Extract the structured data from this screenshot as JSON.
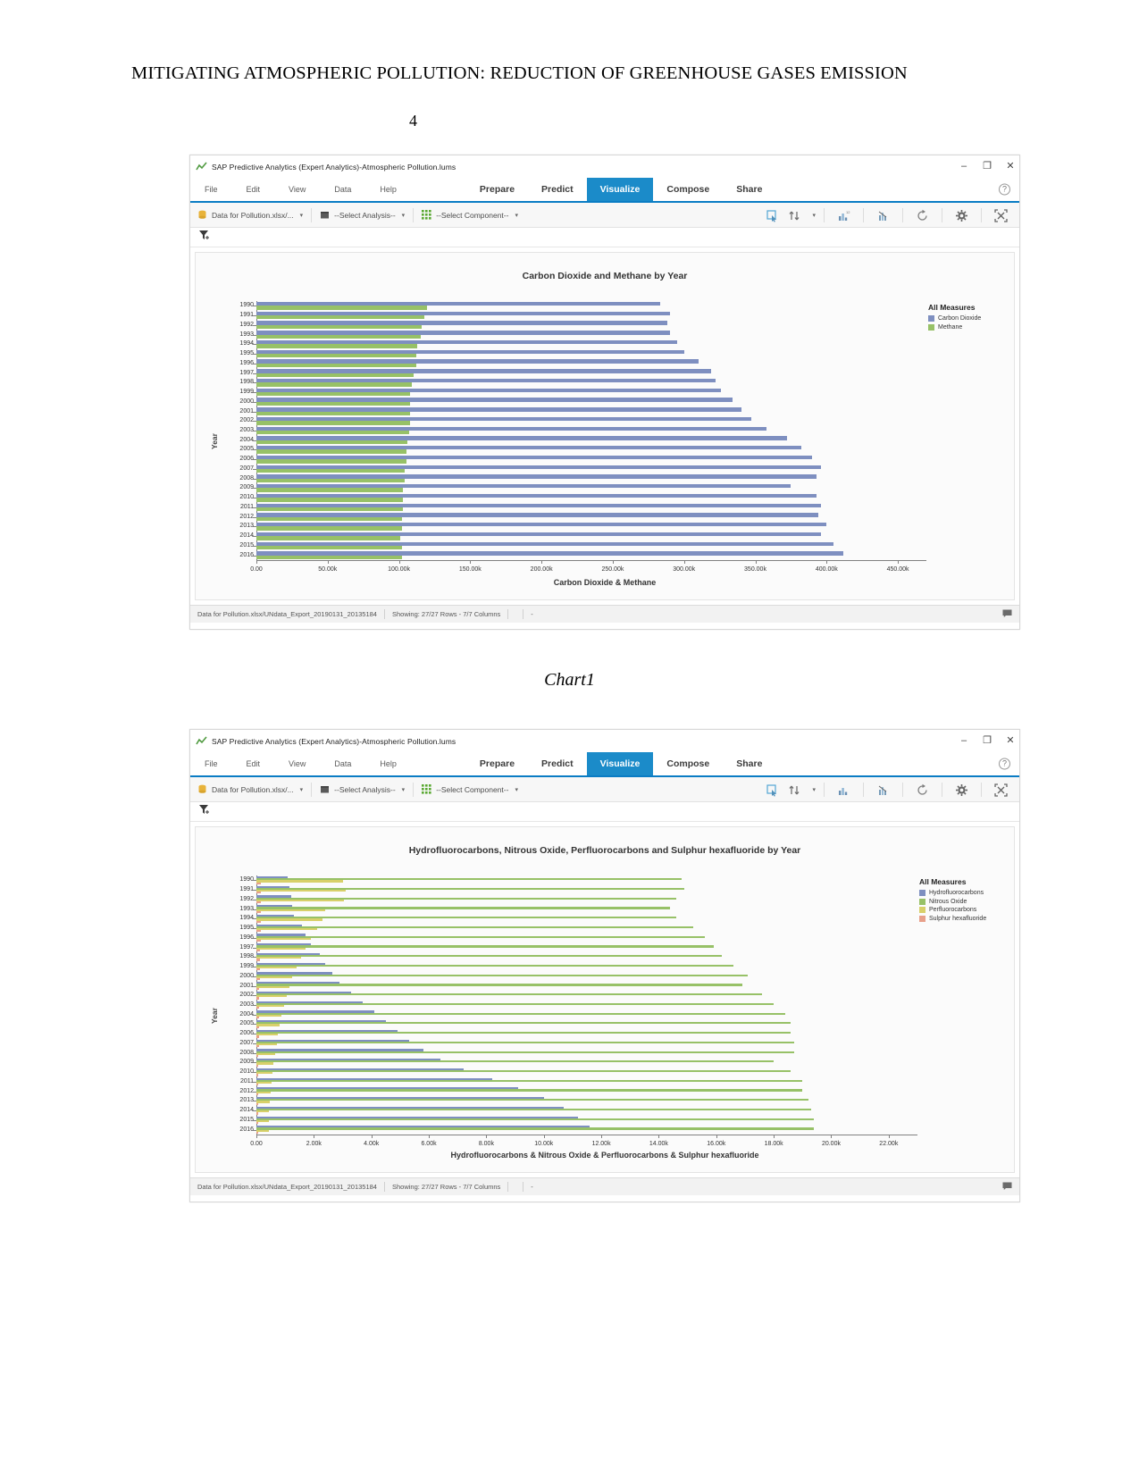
{
  "document": {
    "header_title": "MITIGATING ATMOSPHERIC POLLUTION: REDUCTION OF GREENHOUSE GASES EMISSION",
    "page_number": "4",
    "caption1": "Chart1"
  },
  "window": {
    "title": "SAP Predictive Analytics (Expert Analytics)-Atmospheric Pollution.lums",
    "app_icon": "chart-app-icon",
    "controls": {
      "minimize": "–",
      "maximize": "❐",
      "close": "✕"
    },
    "menu_left": [
      "File",
      "Edit",
      "View",
      "Data",
      "Help"
    ],
    "menu_main": [
      "Prepare",
      "Predict",
      "Visualize",
      "Compose",
      "Share"
    ],
    "menu_active": "Visualize",
    "help_glyph": "?",
    "toolbar": {
      "dataset": "Data for Pollution.xlsx/...",
      "analysis": "--Select Analysis--",
      "component": "--Select Component--",
      "right_icons": [
        "select-tool-icon",
        "sort-icon",
        "chart-bar-icon",
        "chart-scatter-icon",
        "refresh-icon",
        "settings-icon",
        "fullscreen-icon"
      ]
    },
    "filter_icon": "filter-add-icon",
    "status": {
      "file": "Data for Pollution.xlsx/UNdata_Export_20190131_20135184",
      "rows": "Showing: 27/27 Rows - 7/7 Columns",
      "dash": "-",
      "comment_icon": "comment-icon"
    }
  },
  "chart_data": [
    {
      "type": "bar",
      "orientation": "horizontal",
      "title": "Carbon Dioxide and Methane by Year",
      "xlabel": "Carbon Dioxide & Methane",
      "ylabel": "Year",
      "legend_title": "All Measures",
      "legend_position": "right",
      "grid": false,
      "xlim": [
        0,
        470000
      ],
      "xticks": [
        "0.00",
        "50.00k",
        "100.00k",
        "150.00k",
        "200.00k",
        "250.00k",
        "300.00k",
        "350.00k",
        "400.00k",
        "450.00k"
      ],
      "xtick_values": [
        0,
        50000,
        100000,
        150000,
        200000,
        250000,
        300000,
        350000,
        400000,
        450000
      ],
      "categories": [
        "1990",
        "1991",
        "1992",
        "1993",
        "1994",
        "1995",
        "1996",
        "1997",
        "1998",
        "1999",
        "2000",
        "2001",
        "2002",
        "2003",
        "2004",
        "2005",
        "2006",
        "2007",
        "2008",
        "2009",
        "2010",
        "2011",
        "2012",
        "2013",
        "2014",
        "2015",
        "2016"
      ],
      "series": [
        {
          "name": "Carbon Dioxide",
          "color": "#7e8fc0",
          "values": [
            283000,
            290000,
            288000,
            290000,
            295000,
            300000,
            310000,
            319000,
            322000,
            326000,
            334000,
            340000,
            347000,
            358000,
            372000,
            382000,
            390000,
            396000,
            393000,
            375000,
            393000,
            396000,
            394000,
            400000,
            396000,
            405000,
            412000
          ]
        },
        {
          "name": "Methane",
          "color": "#97c167",
          "values": [
            120000,
            118000,
            116000,
            115000,
            113000,
            112000,
            112000,
            110000,
            109000,
            108000,
            108000,
            108000,
            108000,
            107000,
            106000,
            105000,
            105000,
            104000,
            104000,
            103000,
            103000,
            103000,
            102000,
            102000,
            101000,
            102000,
            102000
          ]
        }
      ]
    },
    {
      "type": "bar",
      "orientation": "horizontal",
      "title": "Hydrofluorocarbons, Nitrous Oxide, Perfluorocarbons and Sulphur hexafluoride by Year",
      "xlabel": "Hydrofluorocarbons & Nitrous Oxide & Perfluorocarbons & Sulphur hexafluoride",
      "ylabel": "Year",
      "legend_title": "All Measures",
      "legend_position": "right",
      "grid": false,
      "xlim": [
        0,
        23000
      ],
      "xticks": [
        "0.00",
        "2.00k",
        "4.00k",
        "6.00k",
        "8.00k",
        "10.00k",
        "12.00k",
        "14.00k",
        "16.00k",
        "18.00k",
        "20.00k",
        "22.00k"
      ],
      "xtick_values": [
        0,
        2000,
        4000,
        6000,
        8000,
        10000,
        12000,
        14000,
        16000,
        18000,
        20000,
        22000
      ],
      "categories": [
        "1990",
        "1991",
        "1992",
        "1993",
        "1994",
        "1995",
        "1996",
        "1997",
        "1998",
        "1999",
        "2000",
        "2001",
        "2002",
        "2003",
        "2004",
        "2005",
        "2006",
        "2007",
        "2008",
        "2009",
        "2010",
        "2011",
        "2012",
        "2013",
        "2014",
        "2015",
        "2016"
      ],
      "series": [
        {
          "name": "Hydrofluorocarbons",
          "color": "#7e8fc0",
          "values": [
            1100,
            1150,
            1200,
            1250,
            1300,
            1600,
            1700,
            1900,
            2200,
            2400,
            2650,
            2900,
            3300,
            3700,
            4100,
            4500,
            4900,
            5300,
            5800,
            6400,
            7200,
            8200,
            9100,
            10000,
            10700,
            11200,
            11600
          ]
        },
        {
          "name": "Nitrous Oxide",
          "color": "#97c167",
          "values": [
            14800,
            14900,
            14600,
            14400,
            14600,
            15200,
            15600,
            15900,
            16200,
            16600,
            17100,
            16900,
            17600,
            18000,
            18400,
            18600,
            18600,
            18700,
            18700,
            18000,
            18600,
            19000,
            19000,
            19200,
            19300,
            19400,
            19400
          ]
        },
        {
          "name": "Perfluorocarbons",
          "color": "#d8d06a",
          "values": [
            3000,
            3100,
            3050,
            2400,
            2300,
            2100,
            1900,
            1700,
            1550,
            1400,
            1250,
            1150,
            1050,
            950,
            880,
            820,
            760,
            700,
            660,
            600,
            560,
            520,
            490,
            470,
            450,
            430,
            420
          ]
        },
        {
          "name": "Sulphur hexafluoride",
          "color": "#e8a08a",
          "values": [
            160,
            165,
            160,
            155,
            150,
            145,
            140,
            130,
            125,
            118,
            112,
            106,
            100,
            95,
            90,
            86,
            82,
            78,
            75,
            70,
            68,
            65,
            62,
            60,
            58,
            56,
            55
          ]
        }
      ]
    }
  ],
  "caption2": ""
}
